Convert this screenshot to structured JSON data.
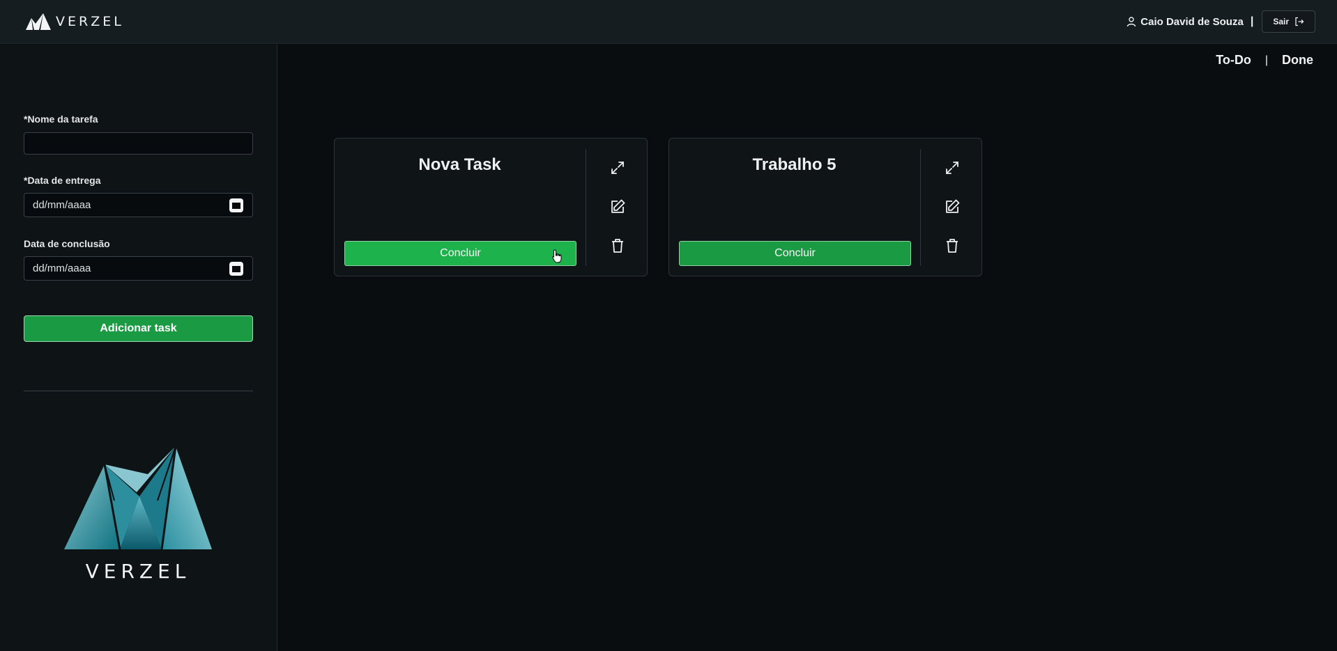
{
  "header": {
    "brand": "VERZEL",
    "user_name": "Caio David de Souza",
    "separator": "|",
    "logout_label": "Sair"
  },
  "sidebar": {
    "task_name_label": "*Nome da tarefa",
    "task_name_value": "",
    "due_date_label": "*Data de entrega",
    "due_date_placeholder": "dd/mm/aaaa",
    "completion_date_label": "Data de conclusão",
    "completion_date_placeholder": "dd/mm/aaaa",
    "add_button_label": "Adicionar task",
    "logo_text": "VERZEL"
  },
  "view_tabs": {
    "todo_label": "To-Do",
    "separator": "|",
    "done_label": "Done"
  },
  "tasks": [
    {
      "title": "Nova Task",
      "button_label": "Concluir"
    },
    {
      "title": "Trabalho 5",
      "button_label": "Concluir"
    }
  ],
  "icons": {
    "expand": "expand-icon",
    "edit": "edit-icon",
    "delete": "trash-icon",
    "calendar": "calendar-icon",
    "user": "user-icon",
    "logout": "logout-icon"
  },
  "colors": {
    "background": "#090d10",
    "header": "#161d21",
    "sidebar": "#0e1316",
    "accent_green": "#1a9a43",
    "accent_green_hover": "#1db24c",
    "logo_teal": "#0e7f8e"
  }
}
